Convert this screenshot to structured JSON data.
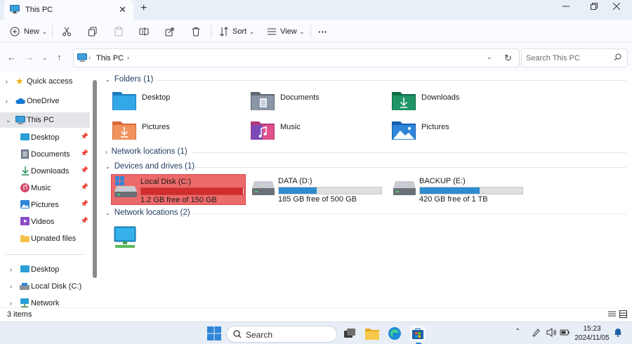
{
  "window": {
    "tab_title": "This PC",
    "new_tab_glyph": "+",
    "close_tab_glyph": "✕"
  },
  "toolbar": {
    "new_label": "New",
    "sort_label": "Sort",
    "view_label": "View",
    "more_label": "···"
  },
  "address": {
    "path": "This PC",
    "search_placeholder": "Search This PC"
  },
  "sidebar": {
    "items": [
      {
        "label": "Quick access",
        "icon": "star-icon"
      },
      {
        "label": "OneDrive",
        "icon": "cloud-icon"
      },
      {
        "label": "This PC",
        "icon": "monitor-icon"
      },
      {
        "label": "Desktop",
        "icon": "desktop-icon"
      },
      {
        "label": "Documents",
        "icon": "documents-icon"
      },
      {
        "label": "Downloads",
        "icon": "download-icon"
      },
      {
        "label": "Music",
        "icon": "music-icon"
      },
      {
        "label": "Pictures",
        "icon": "pictures-icon"
      },
      {
        "label": "Videos",
        "icon": "videos-icon"
      },
      {
        "label": "Upnated files",
        "icon": "folder-icon"
      },
      {
        "label": "Desktop",
        "icon": "desktop-icon"
      },
      {
        "label": "Local Disk (C:)",
        "icon": "drive-icon"
      },
      {
        "label": "Network",
        "icon": "network-icon"
      }
    ]
  },
  "content": {
    "folders_header": "Folders (1)",
    "network_header_1": "Network locations (1)",
    "devices_header": "Devices and drives (1)",
    "network_header_2": "Network locations (2)",
    "folders": [
      {
        "label": "Desktop",
        "icon": "desktop-folder-icon"
      },
      {
        "label": "Documents",
        "icon": "documents-folder-icon"
      },
      {
        "label": "Downloads",
        "icon": "downloads-folder-icon"
      },
      {
        "label": "Pictures",
        "icon": "pictures-download-folder-icon"
      },
      {
        "label": "Music",
        "icon": "music-folder-icon"
      },
      {
        "label": "Pictures",
        "icon": "pictures-folder-icon"
      }
    ],
    "drives": [
      {
        "name": "Local Disk (C:)",
        "free": "1.2 GB free of 150 GB",
        "used_fraction": 0.992
      },
      {
        "name": "DATA (D:)",
        "free": "185 GB free of 500 GB",
        "used_fraction": 0.37
      },
      {
        "name": "BACKUP (E:)",
        "free": "420 GB free of 1 TB",
        "used_fraction": 0.58
      }
    ]
  },
  "status": {
    "item_count": "3 items"
  },
  "taskbar": {
    "search_label": "Search",
    "time": "15:23",
    "date": "2024/11/05"
  },
  "colors": {
    "accent": "#2f8cd0",
    "selected_drive": "#ec6a6a",
    "selected_drive_bar": "#cf2d2d"
  }
}
